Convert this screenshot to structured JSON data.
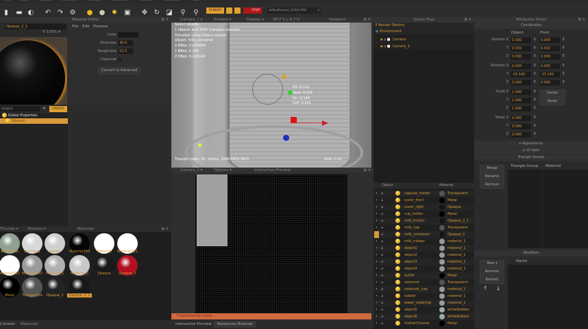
{
  "menu": [
    "File",
    "Edit",
    "Object",
    "Camera",
    "Render",
    "Selection",
    "Render",
    "Window",
    "Help"
  ],
  "toolbar": {
    "render": "RENDER",
    "stop": "STOP",
    "layout": "defaultlayout_1024x768"
  },
  "material_editor": {
    "title": "Material Editor",
    "name": "Opaque_2_1",
    "zoom": "100%",
    "menu": [
      "File",
      "Edit",
      "Preview"
    ],
    "color_label": "Color",
    "shininess_label": "Shininess",
    "shininess": "30.0",
    "roughness_label": "Roughness",
    "roughness": "12.0",
    "clearcoat_label": "Clearcoat",
    "convert": "Convert to Advanced",
    "stage": "stage1",
    "update": "UPDATE",
    "tree": [
      "Global Properties",
      "Opaque"
    ]
  },
  "viewport": {
    "title": "Viewport",
    "camera": "Camera_1",
    "shading": "Shaded",
    "display": "Display",
    "flags": "3D F S L R T D",
    "info": [
      "Select objects",
      "1 objects and 3916 triangles selected",
      "Translate using Object system",
      "Object: milk_container",
      "X BBox: 0.054946",
      "Y BBox: 0.166",
      "Z BBox: 0.116142"
    ],
    "focus": [
      "FD: 0.142",
      "Near: 0.141",
      "Far: 0.144",
      "DoF: 0.002"
    ],
    "status": "Triangle index: 16, Vertex: 1949,3420,3421",
    "grid": "Grid: 1 cm"
  },
  "preview": {
    "title": "Interactive Preview",
    "camera": "Camera_1",
    "options": "Options",
    "progress_text": "Preprocessing scene...",
    "progress": 1.0,
    "tabs": [
      "Interactive Preview",
      "Resources Browser"
    ]
  },
  "scene_tree": {
    "title": "Scene Tree",
    "items": [
      "Render Options",
      "Environment",
      "Camera",
      "Camera_1"
    ],
    "col_object": "Object",
    "col_material": "Material",
    "objects": [
      [
        "capsule_holder",
        "Transparent"
      ],
      [
        "cover_front",
        "Metal"
      ],
      [
        "cover_right",
        "Opaque"
      ],
      [
        "cup_holder",
        "Metal"
      ],
      [
        "milk_button",
        "Opaque_2_1"
      ],
      [
        "milk_cap",
        "Transparent"
      ],
      [
        "milk_container",
        "Opaque_2"
      ],
      [
        "milk_rubber",
        "material_1"
      ],
      [
        "object1",
        "material_1"
      ],
      [
        "object2",
        "material_1"
      ],
      [
        "object3",
        "material_1"
      ],
      [
        "object4",
        "material_1"
      ],
      [
        "outlet",
        "Metal"
      ],
      [
        "reservoir",
        "Transparent"
      ],
      [
        "reservoir_cap",
        "material_1"
      ],
      [
        "rubber",
        "material_1"
      ],
      [
        "water_retaining",
        "material_1"
      ],
      [
        "object5",
        "whiteRubber"
      ],
      [
        "object6",
        "whiteRubber"
      ],
      [
        "frotherChrome",
        "Metal"
      ]
    ]
  },
  "attributes": {
    "title": "Attributes Panel",
    "coordinates": "Coordinates",
    "col_object": "Object",
    "col_pivot": "Pivot",
    "rows": [
      [
        "Position X",
        "0.000",
        "0.000"
      ],
      [
        "Y",
        "0.032",
        "0.032"
      ],
      [
        "Z",
        "0.000",
        "0.000"
      ],
      [
        "Rotation X",
        "0.000",
        "0.000"
      ],
      [
        "Y",
        "-15.142",
        "-15.142"
      ],
      [
        "Z",
        "0.000",
        "0.000"
      ],
      [
        "Scale X",
        "1.000",
        ""
      ],
      [
        "Y",
        "1.000",
        ""
      ],
      [
        "Z",
        "1.000",
        ""
      ],
      [
        "Shear X",
        "0.000",
        ""
      ],
      [
        "Y",
        "0.000",
        ""
      ],
      [
        "Z",
        "0.000",
        ""
      ]
    ],
    "center": "Center",
    "reset": "Reset",
    "appearance": "Appearance",
    "uv_sets": "UV Sets",
    "triangle_groups": "Triangle Groups",
    "merge": "Merge",
    "rename": "Rename",
    "remove": "Remove",
    "col_tg": "Triangle Group",
    "col_mat": "Material",
    "modifiers": "Modifiers",
    "new": "New",
    "remove2": "Remove",
    "refresh": "Refresh",
    "col_name": "Name"
  },
  "materials": {
    "title": "Materials",
    "view": "Thumbs",
    "size": "Medium",
    "items": [
      [
        "whiteRubb",
        "#8fa090"
      ],
      [
        "backdrop",
        "#d8d8d8"
      ],
      [
        "plastic",
        "#cfcfcf"
      ],
      [
        "Material360",
        "#050505"
      ],
      [
        "Material",
        "#ffffff"
      ],
      [
        "Material361",
        "#ffffff"
      ],
      [
        "Material362",
        "#ffffff"
      ],
      [
        "Material363",
        "#9a9a9a"
      ],
      [
        "material_1",
        "#b0b0b0"
      ],
      [
        "material_2",
        "#c8c8c8"
      ],
      [
        "Opaque",
        "#1a1a1a"
      ],
      [
        "Opaque_1",
        "#b01020"
      ],
      [
        "Metal",
        "#000000"
      ],
      [
        "Transparent",
        "#555555"
      ],
      [
        "Opaque_2",
        "#222222"
      ],
      [
        "Opaque_2_1",
        "#181818"
      ]
    ],
    "tabs": [
      "Console",
      "Materials"
    ]
  }
}
